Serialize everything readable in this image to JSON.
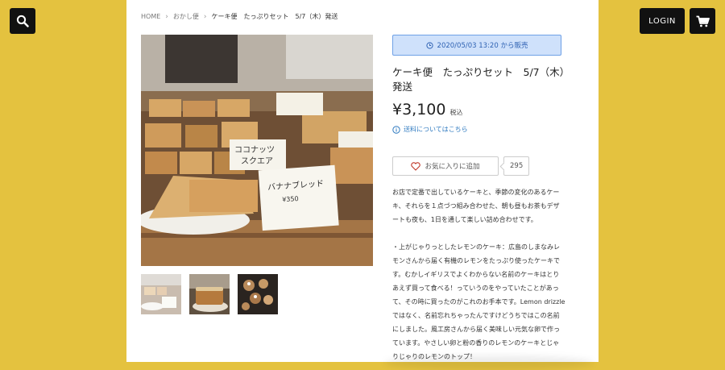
{
  "header": {
    "search_icon": "search-icon",
    "login_label": "LOGIN",
    "cart_icon": "cart-icon"
  },
  "breadcrumb": [
    "HOME",
    "おかし便",
    "ケーキ便　たっぷりセット　5/7（木）発送"
  ],
  "product": {
    "sale_badge": "2020/05/03 13:20 から販売",
    "title": "ケーキ便　たっぷりセット　5/7（木）発送",
    "price": "¥3,100",
    "tax_label": "税込",
    "shipping_link": "送料についてはこちら",
    "favorite_label": "お気に入りに追加",
    "favorite_count": "295",
    "description": [
      "お店で定番で出しているケーキと、季節の変化のあるケー",
      "キ、それらを１点づつ組み合わせた、朝も昼もお茶もデザ",
      "ートも夜も、1日を通して楽しい詰め合わせです。",
      "",
      "・上がじゃりっとしたレモンのケーキ：広島のしまなみレ",
      "モンさんから届く有機のレモンをたっぷり使ったケーキで",
      "す。むかしイギリスでよくわからない名前のケーキはとり",
      "あえず買って食べる！っていうのをやっていたことがあっ",
      "て、その時に買ったのがこれのお手本です。Lemon drizzle",
      "ではなく、名前忘れちゃったんですけどうちではこの名前",
      "にしました。風工房さんから届く美味しい元気な卵で作っ",
      "ています。やさしい卵と粉の香りのレモンのケーキとじゃ",
      "りじゃりのレモンのトップ！"
    ]
  },
  "photo": {
    "card_labels": [
      "ココナッツ\nスクエア",
      "バナナブレッド",
      "¥350"
    ]
  },
  "colors": {
    "background": "#e4c23f",
    "badge_bg": "#cfe1fb",
    "badge_text": "#2f62b3",
    "link": "#2f7ac0"
  }
}
